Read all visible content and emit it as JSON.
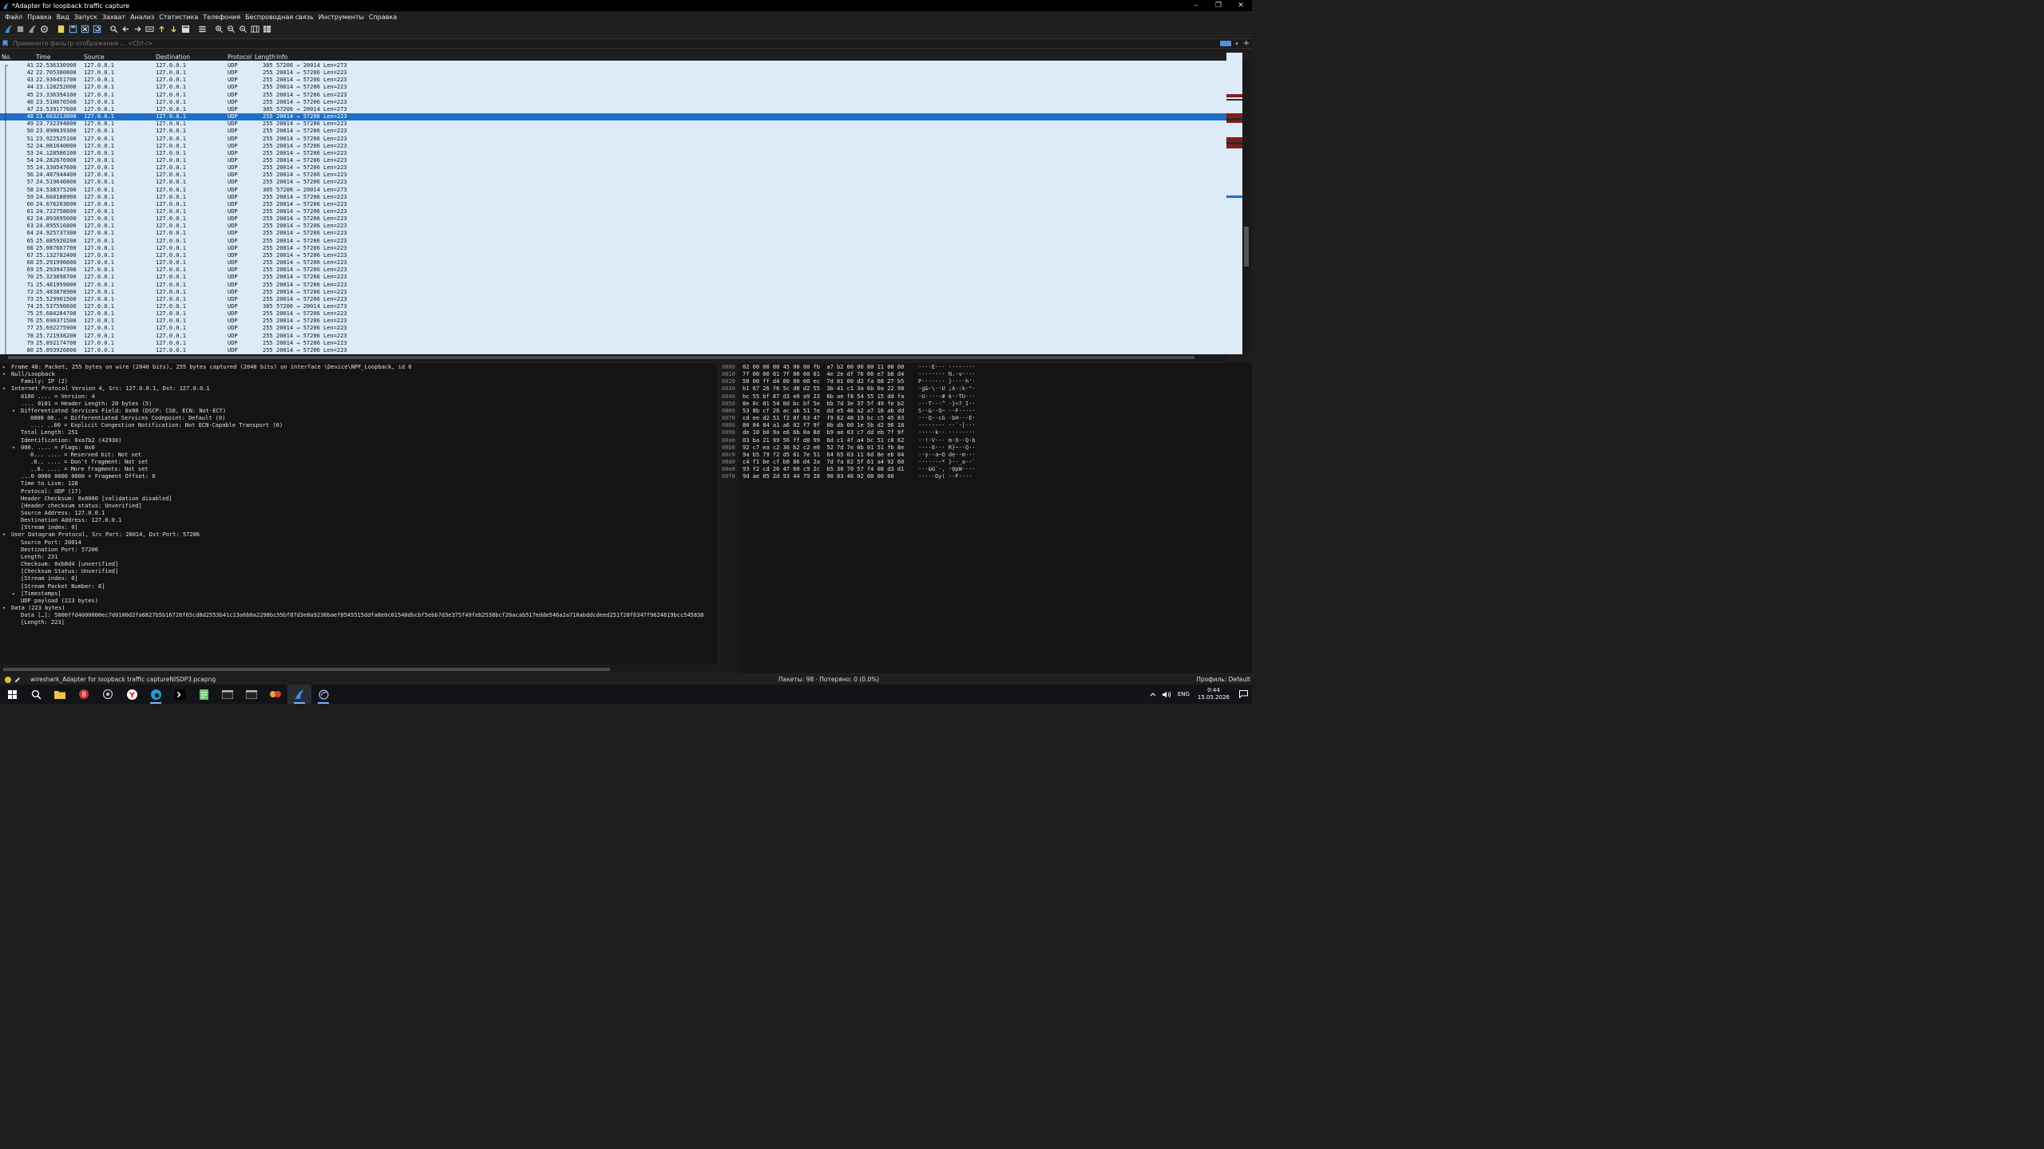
{
  "window": {
    "title": "*Adapter for loopback traffic capture",
    "minimize": "–",
    "maximize": "❐",
    "close": "✕"
  },
  "menu": [
    "Файл",
    "Правка",
    "Вид",
    "Запуск",
    "Захват",
    "Анализ",
    "Статистика",
    "Телефония",
    "Беспроводная связь",
    "Инструменты",
    "Справка"
  ],
  "filter": {
    "placeholder": "Примените фильтр отображения … <Ctrl-/>"
  },
  "packet_list": {
    "columns": [
      "No.",
      "Time",
      "Source",
      "Destination",
      "Protocol",
      "Length",
      "Info"
    ],
    "selected_no": "48",
    "rows": [
      [
        "41",
        "22.536330900",
        "127.0.0.1",
        "127.0.0.1",
        "UDP",
        "305",
        "57206 → 20014 Len=273"
      ],
      [
        "42",
        "22.705380800",
        "127.0.0.1",
        "127.0.0.1",
        "UDP",
        "255",
        "20014 → 57206 Len=223"
      ],
      [
        "43",
        "22.936451700",
        "127.0.0.1",
        "127.0.0.1",
        "UDP",
        "255",
        "20014 → 57206 Len=223"
      ],
      [
        "44",
        "23.128252000",
        "127.0.0.1",
        "127.0.0.1",
        "UDP",
        "255",
        "20014 → 57206 Len=223"
      ],
      [
        "45",
        "23.336394100",
        "127.0.0.1",
        "127.0.0.1",
        "UDP",
        "255",
        "20014 → 57206 Len=223"
      ],
      [
        "46",
        "23.510676500",
        "127.0.0.1",
        "127.0.0.1",
        "UDP",
        "255",
        "20014 → 57206 Len=223"
      ],
      [
        "47",
        "23.539177600",
        "127.0.0.1",
        "127.0.0.1",
        "UDP",
        "305",
        "57206 → 20014 Len=273"
      ],
      [
        "48",
        "23.663213800",
        "127.0.0.1",
        "127.0.0.1",
        "UDP",
        "255",
        "20014 → 57206 Len=223"
      ],
      [
        "49",
        "23.732394800",
        "127.0.0.1",
        "127.0.0.1",
        "UDP",
        "255",
        "20014 → 57206 Len=223"
      ],
      [
        "50",
        "23.890639300",
        "127.0.0.1",
        "127.0.0.1",
        "UDP",
        "255",
        "20014 → 57206 Len=223"
      ],
      [
        "51",
        "23.922525100",
        "127.0.0.1",
        "127.0.0.1",
        "UDP",
        "255",
        "20014 → 57206 Len=223"
      ],
      [
        "52",
        "24.081640000",
        "127.0.0.1",
        "127.0.0.1",
        "UDP",
        "255",
        "20014 → 57206 Len=223"
      ],
      [
        "53",
        "24.128586100",
        "127.0.0.1",
        "127.0.0.1",
        "UDP",
        "255",
        "20014 → 57206 Len=223"
      ],
      [
        "54",
        "24.282676900",
        "127.0.0.1",
        "127.0.0.1",
        "UDP",
        "255",
        "20014 → 57206 Len=223"
      ],
      [
        "55",
        "24.330547600",
        "127.0.0.1",
        "127.0.0.1",
        "UDP",
        "255",
        "20014 → 57206 Len=223"
      ],
      [
        "56",
        "24.487944400",
        "127.0.0.1",
        "127.0.0.1",
        "UDP",
        "255",
        "20014 → 57206 Len=223"
      ],
      [
        "57",
        "24.519646800",
        "127.0.0.1",
        "127.0.0.1",
        "UDP",
        "255",
        "20014 → 57206 Len=223"
      ],
      [
        "58",
        "24.538375200",
        "127.0.0.1",
        "127.0.0.1",
        "UDP",
        "305",
        "57206 → 20014 Len=273"
      ],
      [
        "59",
        "24.668188900",
        "127.0.0.1",
        "127.0.0.1",
        "UDP",
        "255",
        "20014 → 57206 Len=223"
      ],
      [
        "60",
        "24.676203600",
        "127.0.0.1",
        "127.0.0.1",
        "UDP",
        "255",
        "20014 → 57206 Len=223"
      ],
      [
        "61",
        "24.722758600",
        "127.0.0.1",
        "127.0.0.1",
        "UDP",
        "255",
        "20014 → 57206 Len=223"
      ],
      [
        "62",
        "24.893695000",
        "127.0.0.1",
        "127.0.0.1",
        "UDP",
        "255",
        "20014 → 57206 Len=223"
      ],
      [
        "63",
        "24.895516800",
        "127.0.0.1",
        "127.0.0.1",
        "UDP",
        "255",
        "20014 → 57206 Len=223"
      ],
      [
        "64",
        "24.925737300",
        "127.0.0.1",
        "127.0.0.1",
        "UDP",
        "255",
        "20014 → 57206 Len=223"
      ],
      [
        "65",
        "25.085920200",
        "127.0.0.1",
        "127.0.0.1",
        "UDP",
        "255",
        "20014 → 57206 Len=223"
      ],
      [
        "66",
        "25.087667700",
        "127.0.0.1",
        "127.0.0.1",
        "UDP",
        "255",
        "20014 → 57206 Len=223"
      ],
      [
        "67",
        "25.132782400",
        "127.0.0.1",
        "127.0.0.1",
        "UDP",
        "255",
        "20014 → 57206 Len=223"
      ],
      [
        "68",
        "25.291996600",
        "127.0.0.1",
        "127.0.0.1",
        "UDP",
        "255",
        "20014 → 57206 Len=223"
      ],
      [
        "69",
        "25.293947300",
        "127.0.0.1",
        "127.0.0.1",
        "UDP",
        "255",
        "20014 → 57206 Len=223"
      ],
      [
        "70",
        "25.323898700",
        "127.0.0.1",
        "127.0.0.1",
        "UDP",
        "255",
        "20014 → 57206 Len=223"
      ],
      [
        "71",
        "25.481959000",
        "127.0.0.1",
        "127.0.0.1",
        "UDP",
        "255",
        "20014 → 57206 Len=223"
      ],
      [
        "72",
        "25.483878900",
        "127.0.0.1",
        "127.0.0.1",
        "UDP",
        "255",
        "20014 → 57206 Len=223"
      ],
      [
        "73",
        "25.529901500",
        "127.0.0.1",
        "127.0.0.1",
        "UDP",
        "255",
        "20014 → 57206 Len=223"
      ],
      [
        "74",
        "25.537590600",
        "127.0.0.1",
        "127.0.0.1",
        "UDP",
        "305",
        "57206 → 20014 Len=273"
      ],
      [
        "75",
        "25.684284700",
        "127.0.0.1",
        "127.0.0.1",
        "UDP",
        "255",
        "20014 → 57206 Len=223"
      ],
      [
        "76",
        "25.690371500",
        "127.0.0.1",
        "127.0.0.1",
        "UDP",
        "255",
        "20014 → 57206 Len=223"
      ],
      [
        "77",
        "25.692275900",
        "127.0.0.1",
        "127.0.0.1",
        "UDP",
        "255",
        "20014 → 57206 Len=223"
      ],
      [
        "78",
        "25.721938200",
        "127.0.0.1",
        "127.0.0.1",
        "UDP",
        "255",
        "20014 → 57206 Len=223"
      ],
      [
        "79",
        "25.892174700",
        "127.0.0.1",
        "127.0.0.1",
        "UDP",
        "255",
        "20014 → 57206 Len=223"
      ],
      [
        "80",
        "25.893926800",
        "127.0.0.1",
        "127.0.0.1",
        "UDP",
        "255",
        "20014 → 57206 Len=223"
      ]
    ]
  },
  "details": [
    {
      "indent": 0,
      "arrow": "right",
      "text": "Frame 48: Packet, 255 bytes on wire (2040 bits), 255 bytes captured (2040 bits) on interface \\Device\\NPF_Loopback, id 0"
    },
    {
      "indent": 0,
      "arrow": "down",
      "text": "Null/Loopback"
    },
    {
      "indent": 1,
      "arrow": "",
      "text": "Family: IP (2)"
    },
    {
      "indent": 0,
      "arrow": "down",
      "text": "Internet Protocol Version 4, Src: 127.0.0.1, Dst: 127.0.0.1"
    },
    {
      "indent": 1,
      "arrow": "",
      "text": "0100 .... = Version: 4"
    },
    {
      "indent": 1,
      "arrow": "",
      "text": ".... 0101 = Header Length: 20 bytes (5)"
    },
    {
      "indent": 1,
      "arrow": "down",
      "text": "Differentiated Services Field: 0x00 (DSCP: CS0, ECN: Not-ECT)"
    },
    {
      "indent": 2,
      "arrow": "",
      "text": "0000 00.. = Differentiated Services Codepoint: Default (0)"
    },
    {
      "indent": 2,
      "arrow": "",
      "text": ".... ..00 = Explicit Congestion Notification: Not ECN-Capable Transport (0)"
    },
    {
      "indent": 1,
      "arrow": "",
      "text": "Total Length: 251"
    },
    {
      "indent": 1,
      "arrow": "",
      "text": "Identification: 0xa7b2 (42930)"
    },
    {
      "indent": 1,
      "arrow": "down",
      "text": "000. .... = Flags: 0x0"
    },
    {
      "indent": 2,
      "arrow": "",
      "text": "0... .... = Reserved bit: Not set"
    },
    {
      "indent": 2,
      "arrow": "",
      "text": ".0.. .... = Don't fragment: Not set"
    },
    {
      "indent": 2,
      "arrow": "",
      "text": "..0. .... = More fragments: Not set"
    },
    {
      "indent": 1,
      "arrow": "",
      "text": "...0 0000 0000 0000 = Fragment Offset: 0"
    },
    {
      "indent": 1,
      "arrow": "",
      "text": "Time to Live: 128"
    },
    {
      "indent": 1,
      "arrow": "",
      "text": "Protocol: UDP (17)"
    },
    {
      "indent": 1,
      "arrow": "",
      "text": "Header Checksum: 0x0000 [validation disabled]"
    },
    {
      "indent": 1,
      "arrow": "",
      "text": "[Header checksum status: Unverified]"
    },
    {
      "indent": 1,
      "arrow": "",
      "text": "Source Address: 127.0.0.1"
    },
    {
      "indent": 1,
      "arrow": "",
      "text": "Destination Address: 127.0.0.1"
    },
    {
      "indent": 1,
      "arrow": "",
      "text": "[Stream index: 0]"
    },
    {
      "indent": 0,
      "arrow": "down",
      "text": "User Datagram Protocol, Src Port: 20014, Dst Port: 57206"
    },
    {
      "indent": 1,
      "arrow": "",
      "text": "Source Port: 20014"
    },
    {
      "indent": 1,
      "arrow": "",
      "text": "Destination Port: 57206"
    },
    {
      "indent": 1,
      "arrow": "",
      "text": "Length: 231"
    },
    {
      "indent": 1,
      "arrow": "",
      "text": "Checksum: 0xb8d4 [unverified]"
    },
    {
      "indent": 1,
      "arrow": "",
      "text": "[Checksum Status: Unverified]"
    },
    {
      "indent": 1,
      "arrow": "",
      "text": "[Stream index: 0]"
    },
    {
      "indent": 1,
      "arrow": "",
      "text": "[Stream Packet Number: 8]"
    },
    {
      "indent": 1,
      "arrow": "right",
      "text": "[Timestamps]"
    },
    {
      "indent": 1,
      "arrow": "",
      "text": "UDP payload (223 bytes)"
    },
    {
      "indent": 0,
      "arrow": "down",
      "text": "Data (223 bytes)"
    },
    {
      "indent": 1,
      "arrow": "",
      "text": "Data […]: 5000ffd4000000ec7d0100d2fa6827b5b16726f65cd8d2553b41c13a6b0a2298bc55bf87d3e0a9236baef8545515ddfa8e0c01540dbcbf5ebb7d3e375f49feb2538bcf26acab517edde546a2a716abddcdeed251f28f6347f9624819bcc545838"
    },
    {
      "indent": 1,
      "arrow": "",
      "text": "[Length: 223]"
    }
  ],
  "bytes": [
    {
      "off": "0000",
      "hex": "02 00 00 00 45 00 00 fb  a7 b2 00 00 80 11 00 00",
      "ascii": "····E··· ········"
    },
    {
      "off": "0010",
      "hex": "7f 00 00 01 7f 00 00 01  4e 2e df 76 00 e7 b8 d4",
      "ascii": "········ N.·v····"
    },
    {
      "off": "0020",
      "hex": "50 00 ff d4 00 00 00 ec  7d 01 00 d2 fa 68 27 b5",
      "ascii": "P······· }····h'·"
    },
    {
      "off": "0030",
      "hex": "b1 67 26 f6 5c d8 d2 55  3b 41 c1 3a 6b 0a 22 98",
      "ascii": "·g&·\\··U ;A·:k·\"·"
    },
    {
      "off": "0040",
      "hex": "bc 55 bf 87 d3 e0 a9 23  6b ae f8 54 55 15 dd fa",
      "ascii": "·U·····# k··TU···"
    },
    {
      "off": "0050",
      "hex": "8e 0c 01 54 0d bc bf 5e  bb 7d 3e 37 5f 49 fe b2",
      "ascii": "···T···^ ·}>7_I··"
    },
    {
      "off": "0060",
      "hex": "53 8b cf 26 ac ab 51 7e  dd e5 46 a2 a7 16 ab dd",
      "ascii": "S··&··Q~ ··F·····"
    },
    {
      "off": "0070",
      "hex": "cd ee d2 51 f2 8f 63 47  f9 62 48 19 bc c5 45 83",
      "ascii": "···Q··cG ·bH···E·"
    },
    {
      "off": "0080",
      "hex": "80 84 84 a1 a6 02 f7 9f  0b db 60 1e 5b d2 96 18",
      "ascii": "········ ··`·[···"
    },
    {
      "off": "0090",
      "hex": "de 10 b0 9a e6 6b 0a 8d  b9 ae 03 c7 dd eb 7f 9f",
      "ascii": "·····k·· ········"
    },
    {
      "off": "00a0",
      "hex": "03 ba 21 99 56 ff d0 99  6d c1 4f a4 bc 51 c8 62",
      "ascii": "··!·V··· m·O··Q·b"
    },
    {
      "off": "00b0",
      "hex": "92 c7 ea c2 36 b2 c2 e0  52 7d 7e 0b 01 51 fb 8e",
      "ascii": "····6··· R}~··Q··"
    },
    {
      "off": "00c0",
      "hex": "9a b5 79 f2 d5 61 7e 51  64 65 03 11 6d 8e eb 04",
      "ascii": "··y··a~Q de··m···"
    },
    {
      "off": "00d0",
      "hex": "c4 f1 be cf b8 86 d4 2a  7d fa 82 5f 61 a4 92 60",
      "ascii": "·······* }··_a··`"
    },
    {
      "off": "00e0",
      "hex": "93 f2 cd 26 47 60 c9 2c  b5 30 70 57 f4 08 d3 d1",
      "ascii": "···&G`·, ·0pW····"
    },
    {
      "off": "00f0",
      "hex": "9d ae 05 2d 93 44 79 28  90 83 46 02 00 00 00",
      "ascii": "···-·Dy( ··F····"
    }
  ],
  "status": {
    "file": "wireshark_Adapter for loopback traffic captureNISDP3.pcapng",
    "stats": "Пакеты: 98 · Потеряно: 0 (0.0%)",
    "profile": "Профиль: Default"
  },
  "tray": {
    "lang": "ENG",
    "time": "0:44",
    "date": "15.05.2026"
  },
  "colors": {
    "row_bg": "#dcebf7",
    "row_selected": "#1f6fc9",
    "accent": "#3a8ee6"
  }
}
